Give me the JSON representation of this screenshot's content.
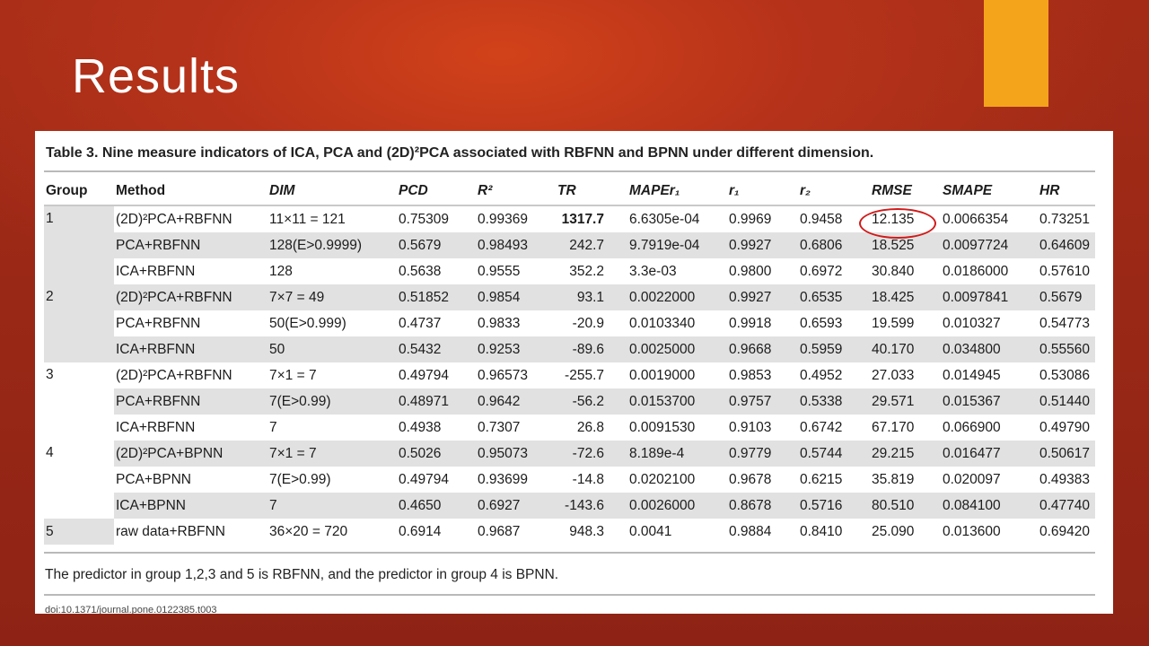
{
  "slide": {
    "title": "Results"
  },
  "colors": {
    "accent": "#f4a41b",
    "background": "#b7331a",
    "highlight_circle": "#d11a1a"
  },
  "table": {
    "caption": "Table 3. Nine measure indicators of ICA, PCA and (2D)²PCA associated with RBFNN and BPNN under different dimension.",
    "headers": [
      "Group",
      "Method",
      "DIM",
      "PCD",
      "R²",
      "TR",
      "MAPEr₁",
      "r₁",
      "r₂",
      "RMSE",
      "SMAPE",
      "HR"
    ],
    "rows": [
      {
        "group": "1",
        "method": "(2D)²PCA+RBFNN",
        "dim": "11×11 = 121",
        "pcd": "0.75309",
        "r2": "0.99369",
        "tr": "1317.7",
        "mape": "6.6305e-04",
        "r1": "0.9969",
        "r2b": "0.9458",
        "rmse": "12.135",
        "smape": "0.0066354",
        "hr": "0.73251"
      },
      {
        "group": "",
        "method": "PCA+RBFNN",
        "dim": "128(E>0.9999)",
        "pcd": "0.5679",
        "r2": "0.98493",
        "tr": "242.7",
        "mape": "9.7919e-04",
        "r1": "0.9927",
        "r2b": "0.6806",
        "rmse": "18.525",
        "smape": "0.0097724",
        "hr": "0.64609"
      },
      {
        "group": "",
        "method": "ICA+RBFNN",
        "dim": "128",
        "pcd": "0.5638",
        "r2": "0.9555",
        "tr": "352.2",
        "mape": "3.3e-03",
        "r1": "0.9800",
        "r2b": "0.6972",
        "rmse": "30.840",
        "smape": "0.0186000",
        "hr": "0.57610"
      },
      {
        "group": "2",
        "method": "(2D)²PCA+RBFNN",
        "dim": "7×7 = 49",
        "pcd": "0.51852",
        "r2": "0.9854",
        "tr": "93.1",
        "mape": "0.0022000",
        "r1": "0.9927",
        "r2b": "0.6535",
        "rmse": "18.425",
        "smape": "0.0097841",
        "hr": "0.5679"
      },
      {
        "group": "",
        "method": "PCA+RBFNN",
        "dim": "50(E>0.999)",
        "pcd": "0.4737",
        "r2": "0.9833",
        "tr": "-20.9",
        "mape": "0.0103340",
        "r1": "0.9918",
        "r2b": "0.6593",
        "rmse": "19.599",
        "smape": "0.010327",
        "hr": "0.54773"
      },
      {
        "group": "",
        "method": "ICA+RBFNN",
        "dim": "50",
        "pcd": "0.5432",
        "r2": "0.9253",
        "tr": "-89.6",
        "mape": "0.0025000",
        "r1": "0.9668",
        "r2b": "0.5959",
        "rmse": "40.170",
        "smape": "0.034800",
        "hr": "0.55560"
      },
      {
        "group": "3",
        "method": "(2D)²PCA+RBFNN",
        "dim": "7×1 = 7",
        "pcd": "0.49794",
        "r2": "0.96573",
        "tr": "-255.7",
        "mape": "0.0019000",
        "r1": "0.9853",
        "r2b": "0.4952",
        "rmse": "27.033",
        "smape": "0.014945",
        "hr": "0.53086"
      },
      {
        "group": "",
        "method": "PCA+RBFNN",
        "dim": "7(E>0.99)",
        "pcd": "0.48971",
        "r2": "0.9642",
        "tr": "-56.2",
        "mape": "0.0153700",
        "r1": "0.9757",
        "r2b": "0.5338",
        "rmse": "29.571",
        "smape": "0.015367",
        "hr": "0.51440"
      },
      {
        "group": "",
        "method": "ICA+RBFNN",
        "dim": "7",
        "pcd": "0.4938",
        "r2": "0.7307",
        "tr": "26.8",
        "mape": "0.0091530",
        "r1": "0.9103",
        "r2b": "0.6742",
        "rmse": "67.170",
        "smape": "0.066900",
        "hr": "0.49790"
      },
      {
        "group": "4",
        "method": "(2D)²PCA+BPNN",
        "dim": "7×1 = 7",
        "pcd": "0.5026",
        "r2": "0.95073",
        "tr": "-72.6",
        "mape": "8.189e-4",
        "r1": "0.9779",
        "r2b": "0.5744",
        "rmse": "29.215",
        "smape": "0.016477",
        "hr": "0.50617"
      },
      {
        "group": "",
        "method": "PCA+BPNN",
        "dim": "7(E>0.99)",
        "pcd": "0.49794",
        "r2": "0.93699",
        "tr": "-14.8",
        "mape": "0.0202100",
        "r1": "0.9678",
        "r2b": "0.6215",
        "rmse": "35.819",
        "smape": "0.020097",
        "hr": "0.49383"
      },
      {
        "group": "",
        "method": "ICA+BPNN",
        "dim": "7",
        "pcd": "0.4650",
        "r2": "0.6927",
        "tr": "-143.6",
        "mape": "0.0026000",
        "r1": "0.8678",
        "r2b": "0.5716",
        "rmse": "80.510",
        "smape": "0.084100",
        "hr": "0.47740"
      },
      {
        "group": "5",
        "method": "raw data+RBFNN",
        "dim": "36×20 = 720",
        "pcd": "0.6914",
        "r2": "0.9687",
        "tr": "948.3",
        "mape": "0.0041",
        "r1": "0.9884",
        "r2b": "0.8410",
        "rmse": "25.090",
        "smape": "0.013600",
        "hr": "0.69420"
      }
    ],
    "footnote": "The predictor in group 1,2,3 and 5 is RBFNN, and the predictor in group 4 is BPNN.",
    "doi": "doi:10.1371/journal.pone.0122385.t003"
  }
}
